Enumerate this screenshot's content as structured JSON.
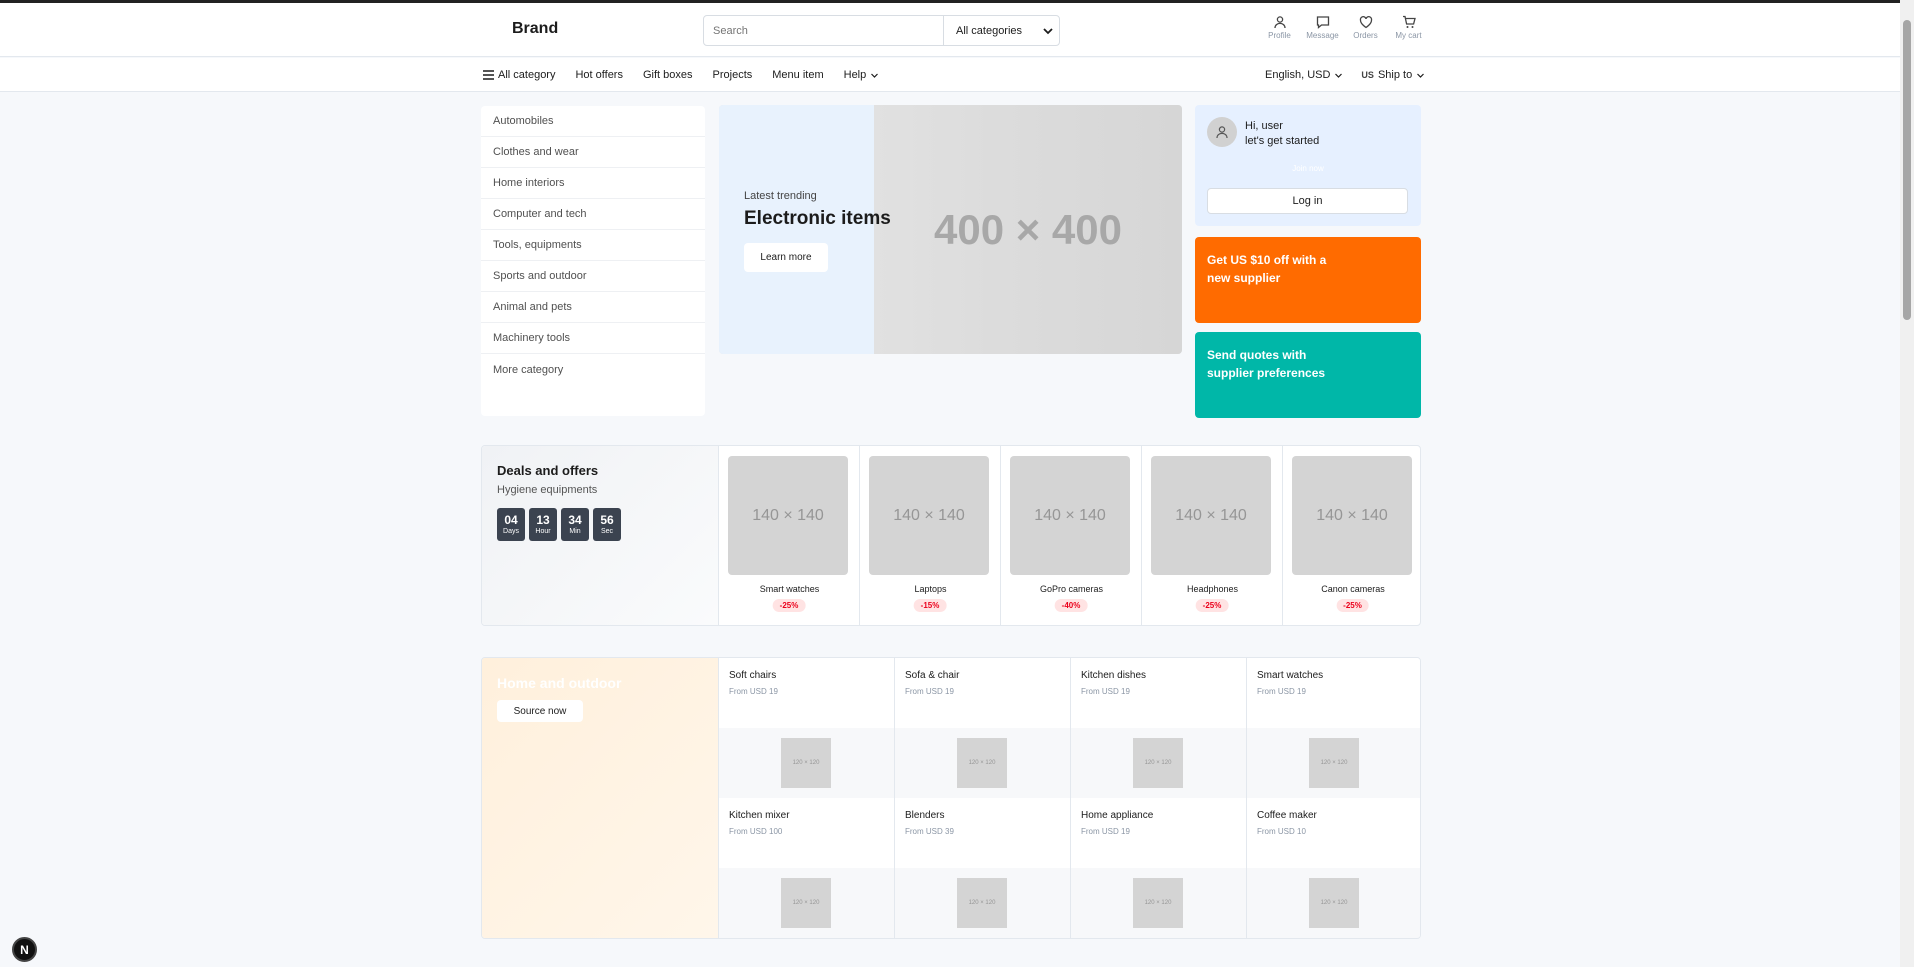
{
  "header": {
    "brand": "Brand",
    "search_placeholder": "Search",
    "category_select": "All categories",
    "icons": [
      {
        "icon": "profile-icon",
        "label": "Profile"
      },
      {
        "icon": "message-icon",
        "label": "Message"
      },
      {
        "icon": "heart-icon",
        "label": "Orders"
      },
      {
        "icon": "cart-icon",
        "label": "My cart"
      }
    ]
  },
  "nav": {
    "items": [
      "All category",
      "Hot offers",
      "Gift boxes",
      "Projects",
      "Menu item",
      "Help"
    ],
    "language": "English, USD",
    "ship_flag": "US",
    "ship_label": "Ship to"
  },
  "sidebar": {
    "categories": [
      "Automobiles",
      "Clothes and wear",
      "Home interiors",
      "Computer and tech",
      "Tools, equipments",
      "Sports and outdoor",
      "Animal and pets",
      "Machinery tools",
      "More category"
    ]
  },
  "banner": {
    "kicker": "Latest trending",
    "title": "Electronic items",
    "button": "Learn more",
    "placeholder": "400 × 400"
  },
  "user": {
    "greeting": "Hi, user",
    "subtitle": "let's get started",
    "join": "Join now",
    "login": "Log in"
  },
  "promos": [
    {
      "text": "Get US $10 off with a new supplier",
      "color": "#ff6b00"
    },
    {
      "text": "Send quotes with supplier preferences",
      "color": "#00b7a8"
    }
  ],
  "deals": {
    "title": "Deals and offers",
    "subtitle": "Hygiene equipments",
    "timer": [
      {
        "value": "04",
        "unit": "Days"
      },
      {
        "value": "13",
        "unit": "Hour"
      },
      {
        "value": "34",
        "unit": "Min"
      },
      {
        "value": "56",
        "unit": "Sec"
      }
    ],
    "items": [
      {
        "name": "Smart watches",
        "discount": "-25%",
        "placeholder": "140 × 140"
      },
      {
        "name": "Laptops",
        "discount": "-15%",
        "placeholder": "140 × 140"
      },
      {
        "name": "GoPro cameras",
        "discount": "-40%",
        "placeholder": "140 × 140"
      },
      {
        "name": "Headphones",
        "discount": "-25%",
        "placeholder": "140 × 140"
      },
      {
        "name": "Canon cameras",
        "discount": "-25%",
        "placeholder": "140 × 140"
      }
    ]
  },
  "home": {
    "title": "Home and outdoor",
    "button": "Source now",
    "items": [
      {
        "name": "Soft chairs",
        "price": "From USD 19",
        "placeholder": "120 × 120"
      },
      {
        "name": "Sofa & chair",
        "price": "From USD 19",
        "placeholder": "120 × 120"
      },
      {
        "name": "Kitchen dishes",
        "price": "From USD 19",
        "placeholder": "120 × 120"
      },
      {
        "name": "Smart watches",
        "price": "From USD 19",
        "placeholder": "120 × 120"
      },
      {
        "name": "Kitchen mixer",
        "price": "From USD 100",
        "placeholder": "120 × 120"
      },
      {
        "name": "Blenders",
        "price": "From USD 39",
        "placeholder": "120 × 120"
      },
      {
        "name": "Home appliance",
        "price": "From USD 19",
        "placeholder": "120 × 120"
      },
      {
        "name": "Coffee maker",
        "price": "From USD 10",
        "placeholder": "120 × 120"
      }
    ]
  },
  "dev_badge": "N"
}
